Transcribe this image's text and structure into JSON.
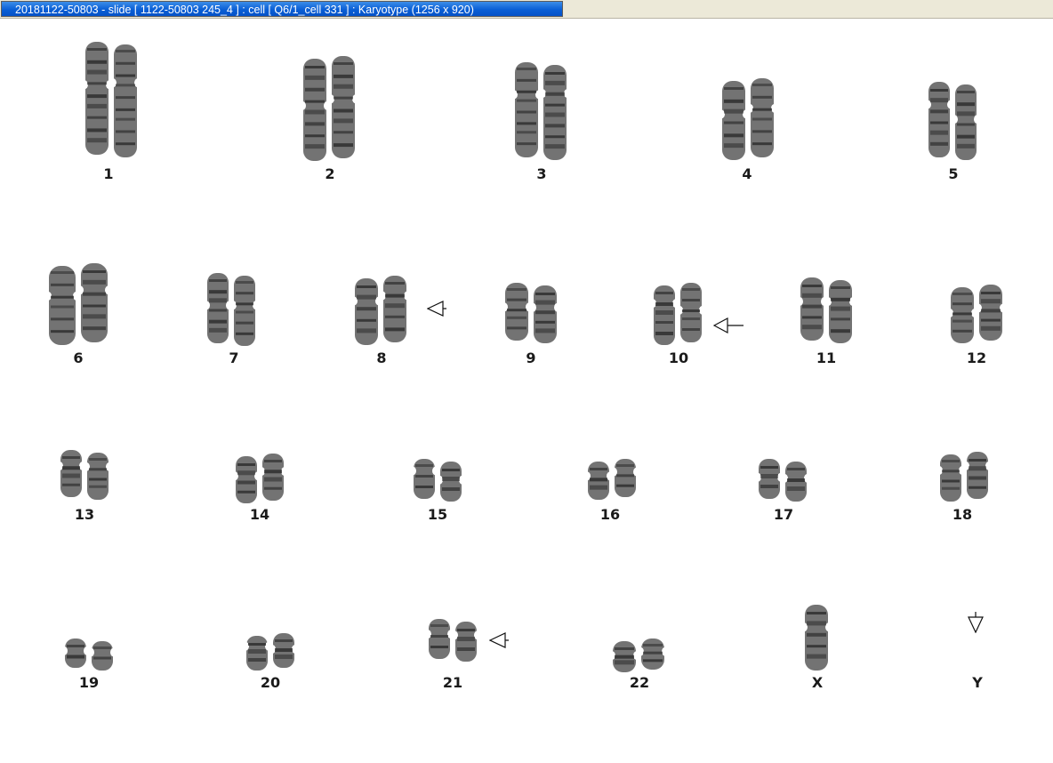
{
  "window": {
    "title": "20181122-50803 - slide [ 1122-50803 245_4 ] : cell [ Q6/1_cell 331 ] : Karyotype  (1256 x 920)"
  },
  "karyotype": {
    "chromosomes": [
      {
        "id": "1",
        "label": "1"
      },
      {
        "id": "2",
        "label": "2"
      },
      {
        "id": "3",
        "label": "3"
      },
      {
        "id": "4",
        "label": "4"
      },
      {
        "id": "5",
        "label": "5"
      },
      {
        "id": "6",
        "label": "6"
      },
      {
        "id": "7",
        "label": "7"
      },
      {
        "id": "8",
        "label": "8"
      },
      {
        "id": "9",
        "label": "9"
      },
      {
        "id": "10",
        "label": "10"
      },
      {
        "id": "11",
        "label": "11"
      },
      {
        "id": "12",
        "label": "12"
      },
      {
        "id": "13",
        "label": "13"
      },
      {
        "id": "14",
        "label": "14"
      },
      {
        "id": "15",
        "label": "15"
      },
      {
        "id": "16",
        "label": "16"
      },
      {
        "id": "17",
        "label": "17"
      },
      {
        "id": "18",
        "label": "18"
      },
      {
        "id": "19",
        "label": "19"
      },
      {
        "id": "20",
        "label": "20"
      },
      {
        "id": "21",
        "label": "21"
      },
      {
        "id": "22",
        "label": "22"
      },
      {
        "id": "X",
        "label": "X"
      },
      {
        "id": "Y",
        "label": "Y"
      }
    ],
    "markers": [
      {
        "chromosome": "8",
        "icon": "arrow-left-outline-icon"
      },
      {
        "chromosome": "10",
        "icon": "arrow-left-long-icon"
      },
      {
        "chromosome": "21",
        "icon": "arrow-left-outline-icon"
      },
      {
        "chromosome": "Y",
        "icon": "arrow-down-outline-icon"
      }
    ],
    "colors": {
      "chromatin": "#5a5a5a",
      "band_dark": "#2a2a2a",
      "label": "#1a1a1a"
    }
  }
}
